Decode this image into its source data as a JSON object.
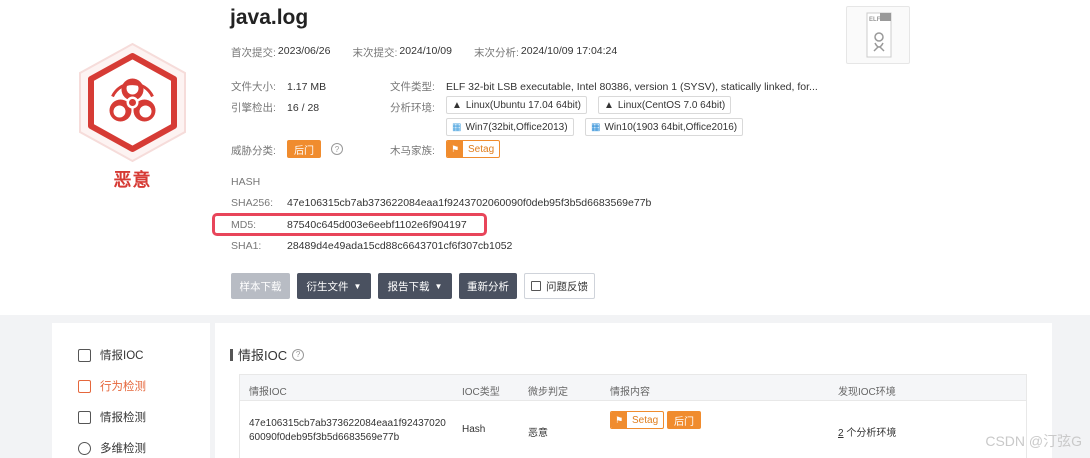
{
  "file": {
    "name": "java.log",
    "verdict": "恶意"
  },
  "dates": {
    "first_submit_label": "首次提交:",
    "first_submit": "2023/06/26",
    "last_submit_label": "末次提交:",
    "last_submit": "2024/10/09",
    "last_analysis_label": "末次分析:",
    "last_analysis": "2024/10/09 17:04:24"
  },
  "file_type_icon": "ELF",
  "info": {
    "size_label": "文件大小:",
    "size": "1.17 MB",
    "type_label": "文件类型:",
    "type": "ELF 32-bit LSB executable, Intel 80386, version 1 (SYSV), statically linked, for...",
    "engine_label": "引擎检出:",
    "engine_hits": "16",
    "engine_total": "/ 28",
    "env_label": "分析环境:",
    "envs": [
      "Linux(Ubuntu 17.04 64bit)",
      "Linux(CentOS 7.0 64bit)",
      "Win7(32bit,Office2013)",
      "Win10(1903 64bit,Office2016)"
    ],
    "threat_label": "威胁分类:",
    "threat_tag": "后门",
    "family_label": "木马家族:",
    "family_tag": "Setag"
  },
  "hash": {
    "header": "HASH",
    "sha256_label": "SHA256:",
    "sha256": "47e106315cb7ab373622084eaa1f9243702060090f0deb95f3b5d6683569e77b",
    "md5_label": "MD5:",
    "md5": "87540c645d003e6eebf1102e6f904197",
    "sha1_label": "SHA1:",
    "sha1": "28489d4e49ada15cd88c6643701cf6f307cb1052"
  },
  "actions": {
    "download_sample": "样本下载",
    "derived_files": "衍生文件",
    "report_download": "报告下载",
    "reanalyze": "重新分析",
    "feedback": "问题反馈"
  },
  "sidebar": {
    "items": [
      {
        "label": "情报IOC",
        "icon": "file-check-icon"
      },
      {
        "label": "行为检测",
        "icon": "activity-icon"
      },
      {
        "label": "情报检测",
        "icon": "table-icon"
      },
      {
        "label": "多维检测",
        "icon": "search-icon"
      }
    ]
  },
  "section": {
    "title": "情报IOC"
  },
  "table": {
    "headers": [
      "情报IOC",
      "IOC类型",
      "微步判定",
      "情报内容",
      "发现IOC环境"
    ],
    "row": {
      "ioc": "47e106315cb7ab373622084eaa1f9243702060090f0deb95f3b5d6683569e77b",
      "type": "Hash",
      "verdict": "恶意",
      "tag1": "Setag",
      "tag2": "后门",
      "env_count": "2",
      "env_suffix": "个分析环境"
    }
  },
  "watermark": "CSDN @汀弦G",
  "colors": {
    "malicious": "#d63b35",
    "accent": "#f08c2e",
    "highlight": "#e8455a"
  }
}
